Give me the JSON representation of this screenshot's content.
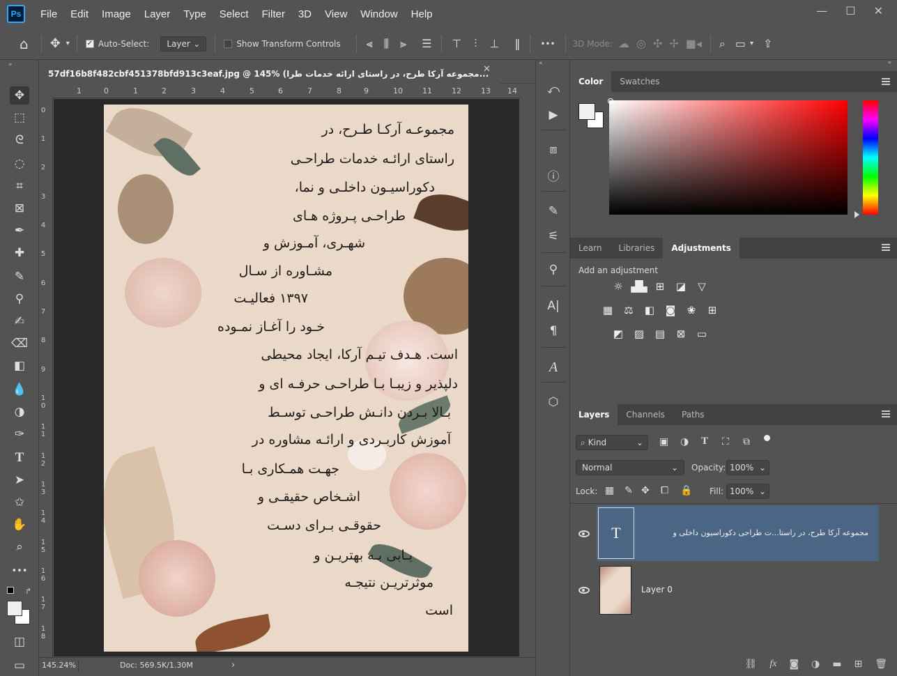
{
  "app": {
    "logo": "Ps"
  },
  "menu": [
    "File",
    "Edit",
    "Image",
    "Layer",
    "Type",
    "Select",
    "Filter",
    "3D",
    "View",
    "Window",
    "Help"
  ],
  "window_controls": {
    "minimize": "—",
    "maximize": "☐",
    "close": "✕"
  },
  "options": {
    "auto_select_label": "Auto-Select:",
    "auto_select_value": "Layer",
    "show_transform_label": "Show Transform Controls",
    "mode_3d_label": "3D Mode:",
    "more": "•••"
  },
  "document": {
    "tab_title": "57df16b8f482cbf451378bfd913c3eaf.jpg @ 145% (مجموعه آرکا طرح، در راستای ارائه خدمات طرا...",
    "close": "✕",
    "ruler_top": [
      "1",
      "0",
      "1",
      "2",
      "3",
      "4",
      "5",
      "6",
      "7",
      "8",
      "9",
      "10",
      "11",
      "12",
      "13",
      "14"
    ],
    "ruler_left": [
      "0",
      "1",
      "2",
      "3",
      "4",
      "5",
      "6",
      "7",
      "8",
      "9",
      "10",
      "11",
      "12",
      "13",
      "14",
      "15",
      "16",
      "17",
      "18"
    ],
    "text_lines": [
      "مجموعـه آرکـا طـرح، در",
      "راستای ارائـه خدمات طراحـی",
      "دکوراسیـون داخلـی و نما،",
      "طراحـی  پـروژه  هـای",
      "شهـری، آمـوزش  و",
      "مشـاوره  از  سـال",
      "۱۳۹۷   فعالیـت",
      "خـود را آغـاز نمـوده",
      "است. هـدف تیـم آرکا، ایجاد محیطی",
      "دلپذیر و زیبـا بـا طراحـی حرفـه ای و",
      "بـالا  بـردن دانـش طراحـی توسـط",
      "آموزش کاربـردی و ارائـه مشاوره در",
      "جهـت همـکاری بـا",
      "اشـخاص حقیقـی و",
      "حقوقـی بـرای دسـت",
      "یـابی  بـه بهتریـن و",
      "موثرتریـن   نتیجـه",
      "است"
    ]
  },
  "status": {
    "zoom": "145.24%",
    "doc": "Doc: 569.5K/1.30M",
    "arrow": "›"
  },
  "color_panel": {
    "tabs": [
      "Color",
      "Swatches"
    ],
    "active": "Color",
    "fg": "#f0f0f0",
    "bg": "#ffffff"
  },
  "adjust_panel": {
    "tabs": [
      "Learn",
      "Libraries",
      "Adjustments"
    ],
    "active": "Adjustments",
    "add_label": "Add an adjustment"
  },
  "layers_panel": {
    "tabs": [
      "Layers",
      "Channels",
      "Paths"
    ],
    "active": "Layers",
    "kind": "Kind",
    "blend": "Normal",
    "opacity_label": "Opacity:",
    "opacity": "100%",
    "lock_label": "Lock:",
    "fill_label": "Fill:",
    "fill": "100%",
    "layers": [
      {
        "name": "مجموعه آرکا طرح، در راستا...ت طراحی دکوراسیون داخلی و",
        "type": "text",
        "selected": true,
        "thumb": "T"
      },
      {
        "name": "Layer 0",
        "type": "image",
        "selected": false
      }
    ]
  },
  "colors": {
    "accent": "#31a8ff",
    "selected_layer": "#4b6584"
  }
}
